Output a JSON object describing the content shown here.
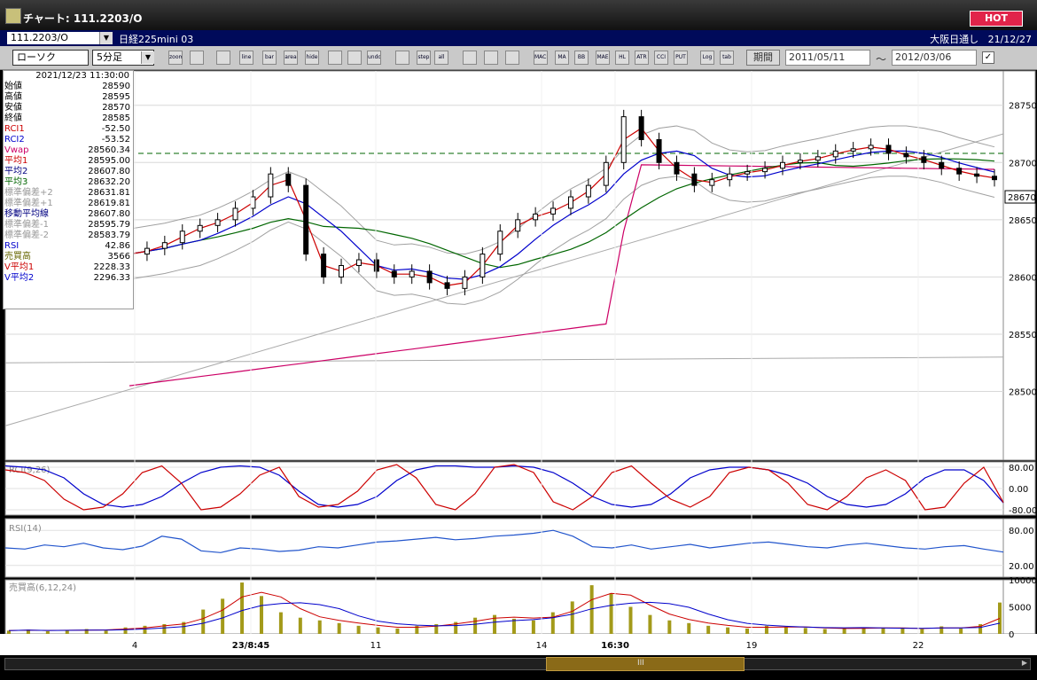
{
  "window": {
    "title": "チャート: 111.2203/O",
    "hot": "HOT"
  },
  "row1": {
    "symbol": "111.2203/O",
    "name": "日経225mini 03",
    "session": "大阪日通し",
    "date": "21/12/27"
  },
  "toolbar": {
    "chart_type": "ローソク",
    "timeframe": "5分足",
    "buttons": [
      "zoom",
      "crosshair",
      "candle",
      "line",
      "bar",
      "area",
      "hide",
      "draw-line",
      "cursor",
      "undo",
      "bar-style",
      "step",
      "all",
      "settings",
      "tools",
      "color",
      "MACD",
      "MA",
      "BB",
      "MAE",
      "HL",
      "ATR",
      "CCI",
      "PUT",
      "Log",
      "tab"
    ],
    "period_label": "期間",
    "date_from": "2011/05/11",
    "tilde": "～",
    "date_to": "2012/03/06"
  },
  "info": {
    "date": "2021/12/23  11:30:00",
    "rows": [
      {
        "label": "始値",
        "value": "28590",
        "color": "#000000"
      },
      {
        "label": "高値",
        "value": "28595",
        "color": "#000000"
      },
      {
        "label": "安値",
        "value": "28570",
        "color": "#000000"
      },
      {
        "label": "終値",
        "value": "28585",
        "color": "#000000"
      },
      {
        "label": "RCI1",
        "value": "-52.50",
        "color": "#cc0000"
      },
      {
        "label": "RCI2",
        "value": "-53.52",
        "color": "#0000cc"
      },
      {
        "label": "Vwap",
        "value": "28560.34",
        "color": "#cc0066"
      },
      {
        "label": "平均1",
        "value": "28595.00",
        "color": "#cc0000"
      },
      {
        "label": "平均2",
        "value": "28607.80",
        "color": "#000080"
      },
      {
        "label": "平均3",
        "value": "28632.20",
        "color": "#006600"
      },
      {
        "label": "標準偏差+2",
        "value": "28631.81",
        "color": "#999999"
      },
      {
        "label": "標準偏差+1",
        "value": "28619.81",
        "color": "#999999"
      },
      {
        "label": "移動平均線",
        "value": "28607.80",
        "color": "#000080"
      },
      {
        "label": "標準偏差-1",
        "value": "28595.79",
        "color": "#999999"
      },
      {
        "label": "標準偏差-2",
        "value": "28583.79",
        "color": "#999999"
      },
      {
        "label": "RSI",
        "value": "42.86",
        "color": "#0000cc"
      },
      {
        "label": "売買高",
        "value": "3566",
        "color": "#666600"
      },
      {
        "label": "V平均1",
        "value": "2228.33",
        "color": "#cc0000"
      },
      {
        "label": "V平均2",
        "value": "2296.33",
        "color": "#0000cc"
      }
    ]
  },
  "colors": {
    "up": "#ffffff",
    "down": "#000000",
    "ma1": "#cc0000",
    "ma2": "#0000cc",
    "ma3": "#006600",
    "vwap": "#cc0066",
    "band": "#a0a0a0",
    "dashed": "#006600",
    "volume": "#a39a1a"
  },
  "chart_data": [
    {
      "type": "candlestick",
      "title": "",
      "y_ticks": [
        "28750",
        "28700",
        "28650",
        "28600",
        "28550",
        "28500"
      ],
      "ylim": [
        28440,
        28780
      ],
      "x_ticks": [
        "4",
        "23/8:45",
        "11",
        "14",
        "16:30",
        "19",
        "22"
      ],
      "last_price": "28670",
      "dashed_level": 28708,
      "close_path": [
        28620,
        28625,
        28630,
        28640,
        28645,
        28650,
        28660,
        28670,
        28690,
        28680,
        28620,
        28600,
        28610,
        28615,
        28605,
        28600,
        28605,
        28595,
        28590,
        28600,
        28620,
        28640,
        28650,
        28655,
        28660,
        28670,
        28680,
        28700,
        28740,
        28720,
        28700,
        28690,
        28680,
        28685,
        28690,
        28692,
        28695,
        28700,
        28702,
        28705,
        28710,
        28712,
        28715,
        28708,
        28705,
        28700,
        28695,
        28690,
        28688,
        28685
      ]
    },
    {
      "type": "line",
      "title": "RCI(9,26)",
      "y_ticks": [
        "80.00",
        "0.00",
        "-80.00"
      ],
      "ylim": [
        -100,
        100
      ],
      "series": [
        {
          "name": "RCI1",
          "values": [
            70,
            60,
            30,
            -40,
            -80,
            -70,
            -20,
            60,
            85,
            20,
            -80,
            -70,
            -20,
            50,
            80,
            -30,
            -70,
            -60,
            -10,
            70,
            90,
            40,
            -60,
            -80,
            -20,
            80,
            90,
            60,
            -50,
            -80,
            -30,
            60,
            85,
            20,
            -40,
            -70,
            -30,
            60,
            80,
            70,
            20,
            -60,
            -80,
            -30,
            40,
            70,
            30,
            -80,
            -70,
            20,
            80,
            -52.5
          ]
        },
        {
          "name": "RCI2",
          "values": [
            85,
            80,
            70,
            40,
            -20,
            -60,
            -70,
            -60,
            -30,
            20,
            60,
            80,
            85,
            80,
            50,
            -10,
            -60,
            -70,
            -60,
            -30,
            30,
            70,
            85,
            85,
            80,
            80,
            85,
            80,
            60,
            20,
            -30,
            -60,
            -70,
            -60,
            -20,
            40,
            70,
            80,
            80,
            70,
            50,
            20,
            -30,
            -60,
            -70,
            -60,
            -20,
            40,
            70,
            70,
            30,
            -53.52
          ]
        }
      ]
    },
    {
      "type": "line",
      "title": "RSI(14)",
      "y_ticks": [
        "80.00",
        "20.00"
      ],
      "ylim": [
        0,
        100
      ],
      "series": [
        {
          "name": "RSI",
          "values": [
            50,
            48,
            55,
            52,
            58,
            50,
            47,
            53,
            70,
            65,
            45,
            42,
            50,
            48,
            44,
            46,
            52,
            50,
            55,
            60,
            62,
            65,
            68,
            64,
            66,
            70,
            72,
            75,
            80,
            70,
            52,
            50,
            55,
            48,
            52,
            56,
            50,
            54,
            58,
            60,
            56,
            52,
            50,
            55,
            58,
            54,
            50,
            48,
            52,
            54,
            48,
            42.86
          ]
        }
      ]
    },
    {
      "type": "bar",
      "title": "売買高(6,12,24)",
      "y_ticks": [
        "10000",
        "5000",
        "0"
      ],
      "ylim": [
        0,
        10000
      ],
      "values": [
        600,
        800,
        500,
        700,
        900,
        600,
        1200,
        1500,
        1800,
        2200,
        4500,
        6500,
        9500,
        7000,
        4000,
        3000,
        2500,
        2000,
        1500,
        1200,
        1000,
        1500,
        1800,
        2200,
        3000,
        3500,
        2800,
        2500,
        4000,
        6000,
        9000,
        7500,
        5000,
        3500,
        2500,
        2000,
        1500,
        1200,
        1000,
        1500,
        1300,
        1100,
        900,
        1000,
        1200,
        1100,
        1000,
        900,
        1400,
        1000,
        1800,
        5800
      ]
    }
  ]
}
